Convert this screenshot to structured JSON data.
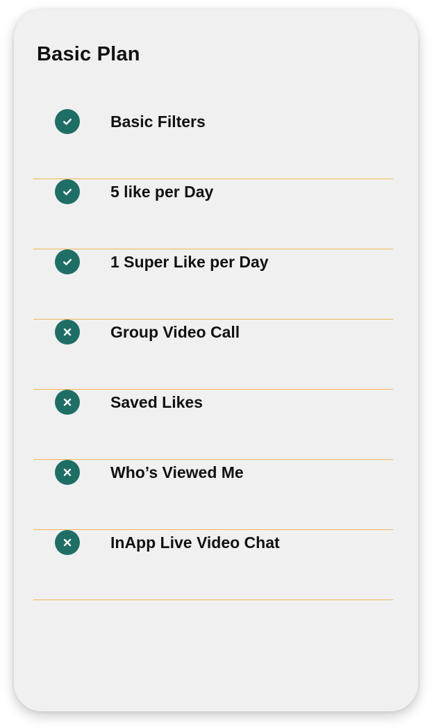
{
  "plan": {
    "title": "Basic Plan",
    "colors": {
      "card_background": "#f0f0f0",
      "icon_background": "#1f6e65",
      "divider": "#f1b655",
      "text": "#111111"
    },
    "features": [
      {
        "label": "Basic Filters",
        "included": true,
        "icon": "check-icon"
      },
      {
        "label": "5 like per Day",
        "included": true,
        "icon": "check-icon"
      },
      {
        "label": "1 Super Like per Day",
        "included": true,
        "icon": "check-icon"
      },
      {
        "label": "Group Video Call",
        "included": false,
        "icon": "close-icon"
      },
      {
        "label": "Saved Likes",
        "included": false,
        "icon": "close-icon"
      },
      {
        "label": "Who’s Viewed Me",
        "included": false,
        "icon": "close-icon"
      },
      {
        "label": "InApp Live Video Chat",
        "included": false,
        "icon": "close-icon"
      }
    ]
  }
}
